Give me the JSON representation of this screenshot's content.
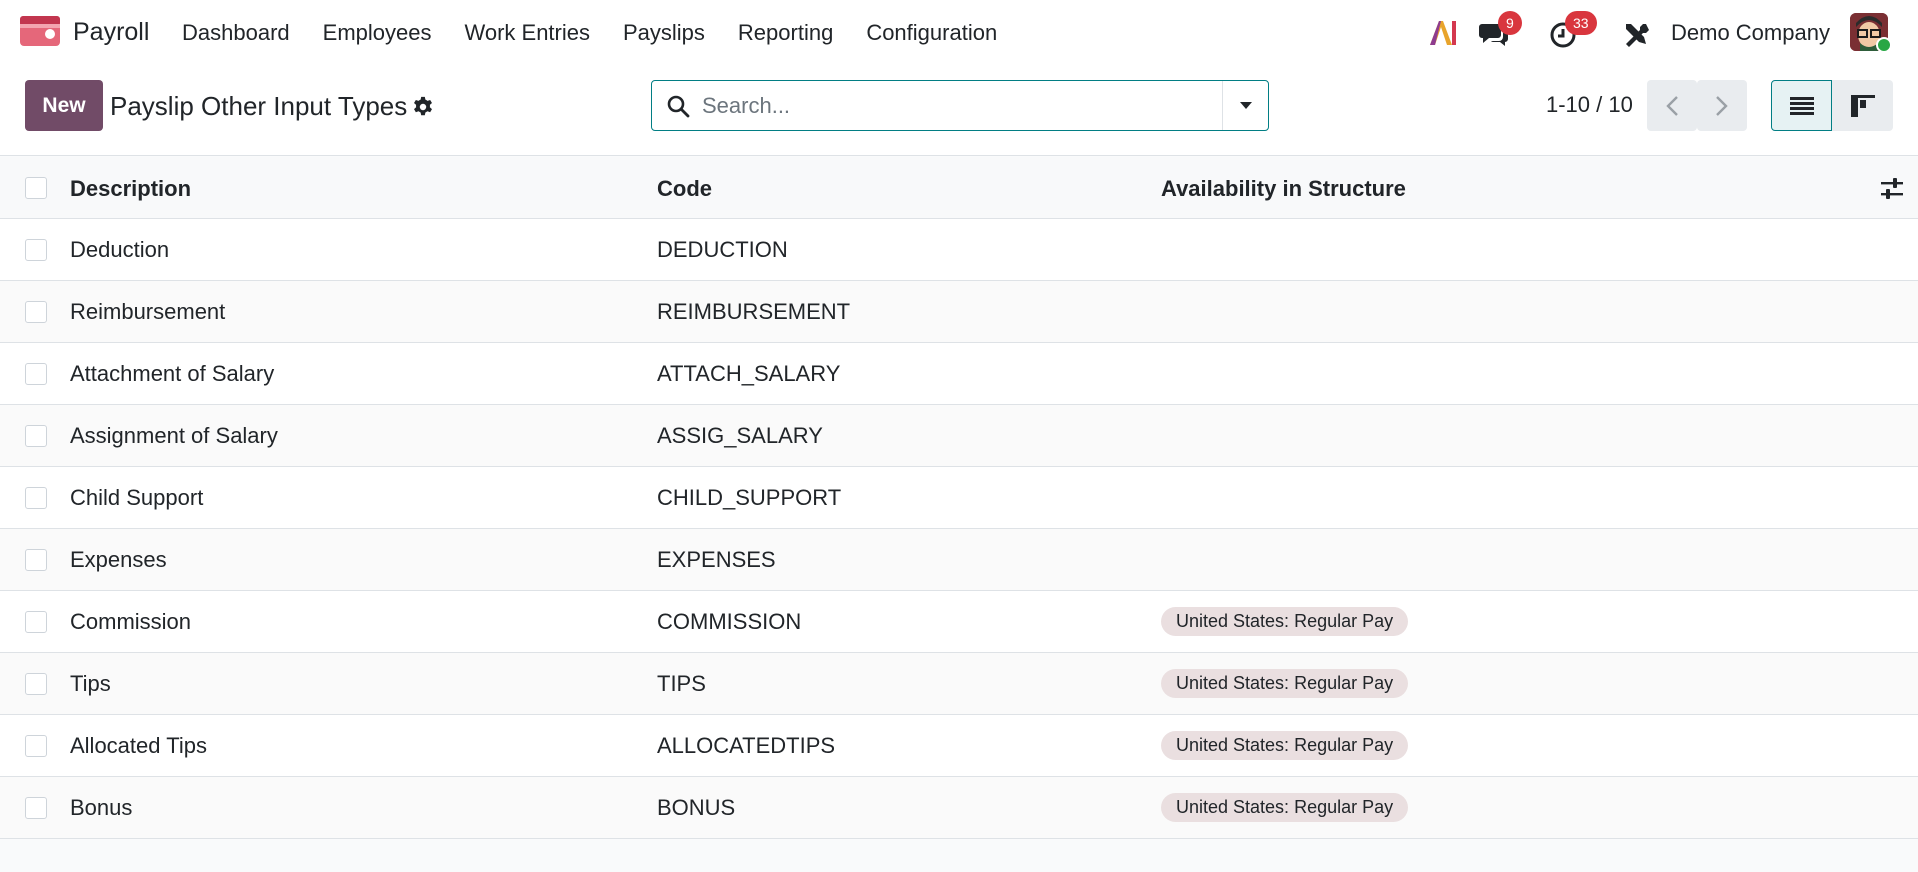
{
  "app": {
    "name": "Payroll",
    "menu": [
      {
        "id": "dashboard",
        "label": "Dashboard"
      },
      {
        "id": "employees",
        "label": "Employees"
      },
      {
        "id": "work-entries",
        "label": "Work Entries"
      },
      {
        "id": "payslips",
        "label": "Payslips"
      },
      {
        "id": "reporting",
        "label": "Reporting"
      },
      {
        "id": "configuration",
        "label": "Configuration"
      }
    ]
  },
  "systray": {
    "messages_count": "9",
    "activities_count": "33",
    "company": "Demo Company",
    "ai_icon": "ai-icon",
    "messages_icon": "chat-bubbles-icon",
    "activities_icon": "clock-icon",
    "tools_icon": "tools-icon"
  },
  "control_panel": {
    "new_label": "New",
    "title": "Payslip Other Input Types",
    "search_placeholder": "Search...",
    "pager": "1-10 / 10"
  },
  "table": {
    "columns": {
      "description": "Description",
      "code": "Code",
      "availability": "Availability in Structure"
    },
    "rows": [
      {
        "description": "Deduction",
        "code": "DEDUCTION",
        "structure": ""
      },
      {
        "description": "Reimbursement",
        "code": "REIMBURSEMENT",
        "structure": ""
      },
      {
        "description": "Attachment of Salary",
        "code": "ATTACH_SALARY",
        "structure": ""
      },
      {
        "description": "Assignment of Salary",
        "code": "ASSIG_SALARY",
        "structure": ""
      },
      {
        "description": "Child Support",
        "code": "CHILD_SUPPORT",
        "structure": ""
      },
      {
        "description": "Expenses",
        "code": "EXPENSES",
        "structure": ""
      },
      {
        "description": "Commission",
        "code": "COMMISSION",
        "structure": "United States: Regular Pay"
      },
      {
        "description": "Tips",
        "code": "TIPS",
        "structure": "United States: Regular Pay"
      },
      {
        "description": "Allocated Tips",
        "code": "ALLOCATEDTIPS",
        "structure": "United States: Regular Pay"
      },
      {
        "description": "Bonus",
        "code": "BONUS",
        "structure": "United States: Regular Pay"
      }
    ]
  },
  "colors": {
    "brand": "#714b67",
    "accent": "#017e84",
    "badge": "#d9363e",
    "tag": "#eadfe0"
  }
}
